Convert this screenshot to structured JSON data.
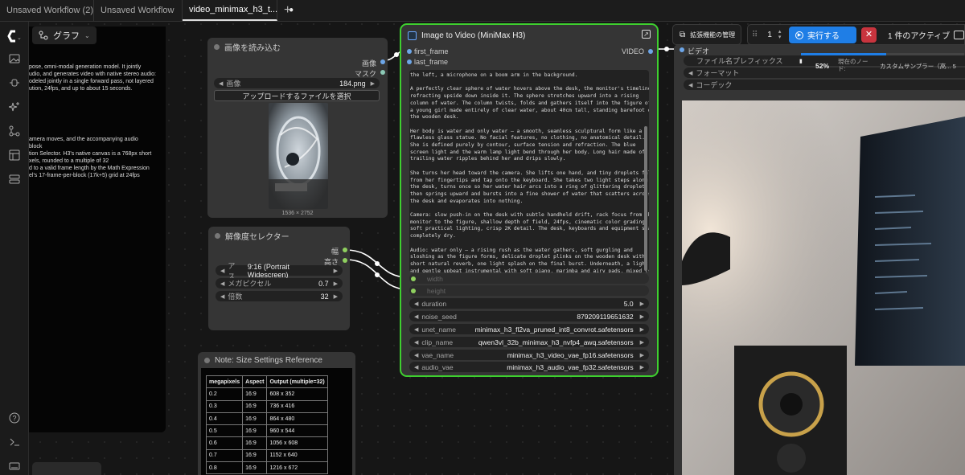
{
  "tabs": [
    {
      "label": "Unsaved Workflow (2)"
    },
    {
      "label": "Unsaved Workflow"
    },
    {
      "label": "video_minimax_h3_t...",
      "modified": "●"
    }
  ],
  "tab_add": "+",
  "graph_button": {
    "label": "グラフ"
  },
  "doc_panel": {
    "lines_a": [
      "pose, omni-modal generation model. It jointly",
      "udio, and generates video with native stereo audio:",
      "odeled jointly in a single forward pass, not layered",
      "ution, 24fps, and up to about 15 seconds."
    ],
    "lines_b": [
      "amera moves, and the accompanying audio",
      "block",
      "tion Selector. H3's native canvas is a 768px short",
      "xels, rounded to a multiple of 32",
      "d to a valid frame length by the Math Expression",
      "el's 17-frame-per-block (17k+5) grid at 24fps"
    ]
  },
  "load_image_node": {
    "title": "画像を読み込む",
    "outputs": [
      "画像",
      "マスク"
    ],
    "image_widget": {
      "label": "画像",
      "value": "184.png"
    },
    "upload_button": "アップロードするファイルを選択",
    "dimensions": "1536 × 2752"
  },
  "resolution_node": {
    "title": "解像度セレクター",
    "outputs": [
      "幅",
      "高さ"
    ],
    "widgets": [
      {
        "label": "アス...",
        "value": "9:16 (Portrait Widescreen)"
      },
      {
        "label": "メガピクセル",
        "value": "0.7"
      },
      {
        "label": "倍数",
        "value": "32"
      }
    ]
  },
  "note_node": {
    "title": "Note: Size Settings Reference",
    "headers": [
      "megapixels",
      "Aspect",
      "Output (multiple=32)"
    ],
    "rows": [
      [
        "0.2",
        "16:9",
        "608 x 352"
      ],
      [
        "0.3",
        "16:9",
        "736 x 416"
      ],
      [
        "0.4",
        "16:9",
        "864 x 480"
      ],
      [
        "0.5",
        "16:9",
        "960 x 544"
      ],
      [
        "0.6",
        "16:9",
        "1056 x 608"
      ],
      [
        "0.7",
        "16:9",
        "1152 x 640"
      ],
      [
        "0.8",
        "16:9",
        "1216 x 672"
      ]
    ]
  },
  "i2v_node": {
    "title": "Image to Video (MiniMax H3)",
    "inputs": [
      "first_frame",
      "last_frame"
    ],
    "output": "VIDEO",
    "prompt_paragraphs": [
      "the left, a microphone on a boom arm in the background.",
      "A perfectly clear sphere of water hovers above the desk, the monitor's timeline\nrefracting upside down inside it. The sphere stretches upward into a rising\ncolumn of water. The column twists, folds and gathers itself into the figure of\na young girl made entirely of clear water, about 40cm tall, standing barefoot on\nthe wooden desk.",
      "Her body is water and only water — a smooth, seamless sculptural form like a\nflawless glass statue. No facial features, no clothing, no anatomical detail.\nShe is defined purely by contour, surface tension and refraction. The blue\nscreen light and the warm lamp light bend through her body. Long hair made of\ntrailing water ripples behind her and drips slowly.",
      "She turns her head toward the camera. She lifts one hand, and tiny droplets fall\nfrom her fingertips and tap onto the keyboard. She takes two light steps along\nthe desk, turns once so her water hair arcs into a ring of glittering droplets,\nthen springs upward and bursts into a fine shower of water that scatters across\nthe desk and evaporates into nothing.",
      "Camera: slow push-in on the desk with subtle handheld drift, rack focus from the\nmonitor to the figure, shallow depth of field, 24fps, cinematic color grading,\nsoft practical lighting, crisp 2K detail. The desk, keyboards and equipment stay\ncompletely dry.",
      "Audio: water only — a rising rush as the water gathers, soft gurgling and\nsloshing as the figure forms, delicate droplet plinks on the wooden desk with\nshort natural reverb, one light splash on the final burst. Underneath, a light\nand gentle upbeat instrumental with soft piano, marimba and airy pads, mixed low\nso the water sounds stay in front. No dialogue, no voiceover, no singing, no\nnarration."
    ],
    "disabled_widgets": [
      "width",
      "height"
    ],
    "widgets": [
      {
        "label": "duration",
        "value": "5.0"
      },
      {
        "label": "noise_seed",
        "value": "879209119651632"
      },
      {
        "label": "unet_name",
        "value": "minimax_h3_fl2va_pruned_int8_convrot.safetensors"
      },
      {
        "label": "clip_name",
        "value": "qwen3vl_32b_minimax_h3_nvfp4_awq.safetensors"
      },
      {
        "label": "vae_name",
        "value": "minimax_h3_video_vae_fp16.safetensors"
      },
      {
        "label": "audio_vae",
        "value": "minimax_h3_audio_vae_fp32.safetensors"
      }
    ]
  },
  "video_node": {
    "input": "ビデオ",
    "widgets": [
      {
        "label": "ファイル名プレフィックス"
      },
      {
        "label": "フォーマット"
      },
      {
        "label": "コーデック"
      }
    ]
  },
  "toolbar": {
    "extensions": "拡張機能の管理",
    "batch_count": "1",
    "run": "実行する",
    "active": "1 件のアクティブ"
  },
  "progress": {
    "percent": "52%",
    "fraction": 0.52,
    "node_label": "現在のノー ド:",
    "sampler": "カスタムサンプラー（高... 5"
  },
  "colors": {
    "accent_green": "#3ecf2f",
    "run_blue": "#1f7ee6",
    "stop_red": "#c9343e"
  }
}
